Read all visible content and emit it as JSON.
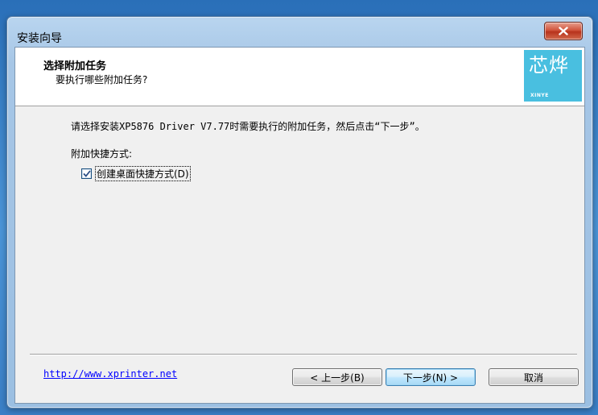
{
  "window": {
    "title": "安装向导"
  },
  "header": {
    "title": "选择附加任务",
    "subtitle": "要执行哪些附加任务?",
    "logo_mark": "芯烨",
    "logo_text": "XINYE",
    "logo_color": "#49bfe0"
  },
  "content": {
    "description": "请选择安装XP5876 Driver V7.77时需要执行的附加任务，然后点击“下一步”。",
    "group_label": "附加快捷方式:",
    "checkbox": {
      "label": "创建桌面快捷方式(D)",
      "checked": true
    }
  },
  "footer": {
    "link": "http://www.xprinter.net",
    "back_label": "< 上一步(B)",
    "next_label": "下一步(N) >",
    "cancel_label": "取消"
  },
  "icons": {
    "close": "close-icon",
    "check": "checkmark-icon"
  },
  "colors": {
    "link": "#0000ff",
    "close_button": "#c94a32"
  }
}
